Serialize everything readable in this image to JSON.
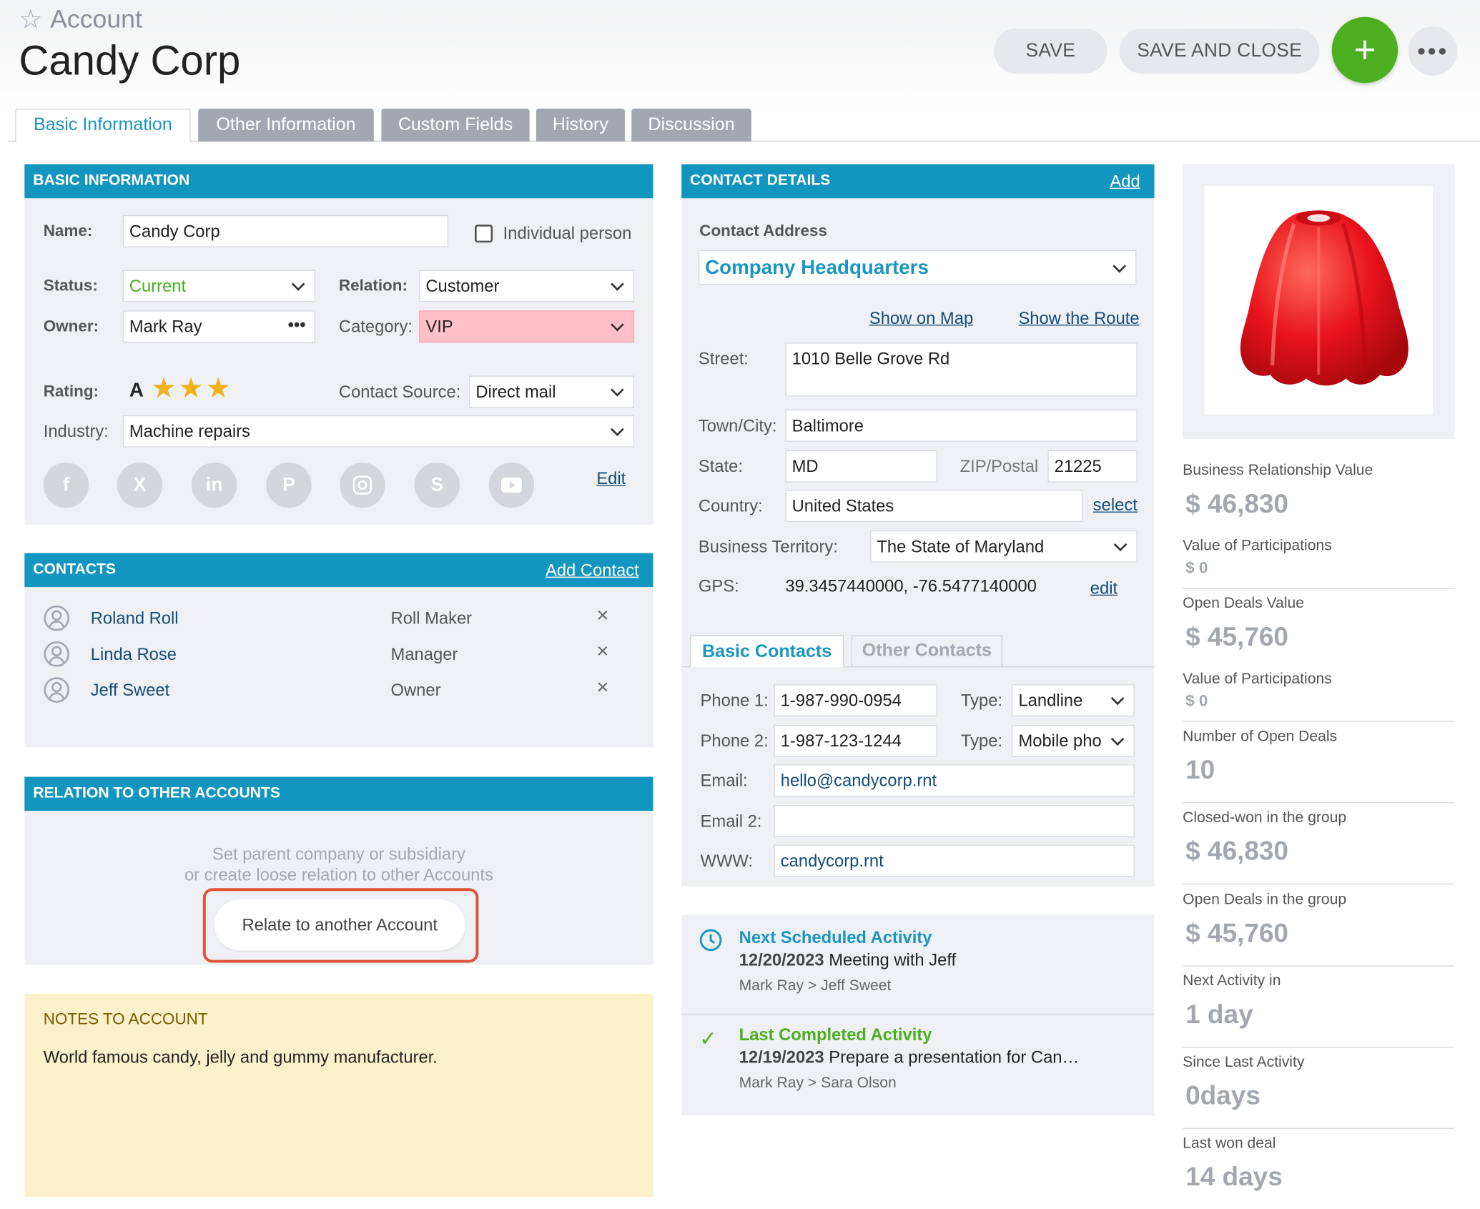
{
  "header": {
    "breadcrumb": "Account",
    "title": "Candy Corp",
    "save_label": "SAVE",
    "save_close_label": "SAVE AND CLOSE",
    "add_label": "+",
    "more_label": "•••"
  },
  "tabs": [
    {
      "label": "Basic Information",
      "active": true
    },
    {
      "label": "Other Information"
    },
    {
      "label": "Custom Fields"
    },
    {
      "label": "History"
    },
    {
      "label": "Discussion"
    }
  ],
  "basic": {
    "header": "BASIC INFORMATION",
    "name_label": "Name:",
    "name_value": "Candy Corp",
    "individual_label": "Individual person",
    "status_label": "Status:",
    "status_value": "Current",
    "status_color": "#4caf1f",
    "relation_label": "Relation:",
    "relation_value": "Customer",
    "owner_label": "Owner:",
    "owner_value": "Mark Ray",
    "owner_more": "•••",
    "category_label": "Category:",
    "category_value": "VIP",
    "category_bg": "#ffc0cb",
    "rating_label": "Rating:",
    "rating_value": "A",
    "rating_stars": 3,
    "source_label": "Contact Source:",
    "source_value": "Direct mail",
    "industry_label": "Industry:",
    "industry_value": "Machine repairs",
    "social_icons": [
      "facebook-icon",
      "x-icon",
      "linkedin-icon",
      "pinterest-icon",
      "instagram-icon",
      "skype-icon",
      "youtube-icon"
    ],
    "edit_label": "Edit"
  },
  "contacts": {
    "header": "CONTACTS",
    "add_label": "Add Contact",
    "items": [
      {
        "name": "Roland Roll",
        "role": "Roll Maker"
      },
      {
        "name": "Linda Rose",
        "role": "Manager"
      },
      {
        "name": "Jeff Sweet",
        "role": "Owner"
      }
    ]
  },
  "relation": {
    "header": "RELATION TO OTHER ACCOUNTS",
    "line1": "Set parent company or subsidiary",
    "line2": "or create loose relation to other Accounts",
    "button": "Relate to another Account"
  },
  "notes": {
    "header": "NOTES TO ACCOUNT",
    "text": "World famous candy, jelly and gummy manufacturer."
  },
  "contact_details": {
    "header": "CONTACT DETAILS",
    "add_label": "Add",
    "address_label": "Contact Address",
    "address_value": "Company Headquarters",
    "show_map": "Show on Map",
    "show_route": "Show the Route",
    "street_label": "Street:",
    "street_value": "1010 Belle Grove Rd",
    "town_label": "Town/City:",
    "town_value": "Baltimore",
    "state_label": "State:",
    "state_value": "MD",
    "zip_label": "ZIP/Postal",
    "zip_value": "21225",
    "country_label": "Country:",
    "country_value": "United States",
    "select_label": "select",
    "territory_label": "Business Territory:",
    "territory_value": "The State of Maryland",
    "gps_label": "GPS:",
    "gps_value": "39.3457440000, -76.5477140000",
    "gps_edit": "edit",
    "subtab_basic": "Basic Contacts",
    "subtab_other": "Other Contacts",
    "phone1_label": "Phone 1:",
    "phone1_value": "1-987-990-0954",
    "type_label": "Type:",
    "phone1_type": "Landline",
    "phone2_label": "Phone 2:",
    "phone2_value": "1-987-123-1244",
    "phone2_type": "Mobile pho",
    "email_label": "Email:",
    "email_value": "hello@candycorp.rnt",
    "email2_label": "Email 2:",
    "email2_value": "",
    "www_label": "WWW:",
    "www_value": "candycorp.rnt"
  },
  "activities": {
    "next_title": "Next Scheduled Activity",
    "next_date": "12/20/2023",
    "next_text": "Meeting with Jeff",
    "next_people": "Mark Ray > Jeff Sweet",
    "last_title": "Last Completed Activity",
    "last_date": "12/19/2023",
    "last_text": "Prepare a presentation for Can…",
    "last_people": "Mark Ray > Sara Olson"
  },
  "kpis": [
    {
      "label": "Business Relationship Value",
      "value": "$ 46,830",
      "sub_label": "Value of Participations",
      "sub_value": "$ 0"
    },
    {
      "label": "Open Deals Value",
      "value": "$ 45,760",
      "sub_label": "Value of Participations",
      "sub_value": "$ 0"
    },
    {
      "label": "Number of Open Deals",
      "value": "10"
    },
    {
      "label": "Closed-won in the group",
      "value": "$ 46,830"
    },
    {
      "label": "Open Deals in the group",
      "value": "$ 45,760"
    },
    {
      "label": "Next Activity in",
      "value": "1 day"
    },
    {
      "label": "Since Last Activity",
      "value": "0days"
    },
    {
      "label": "Last won deal",
      "value": "14 days"
    }
  ]
}
